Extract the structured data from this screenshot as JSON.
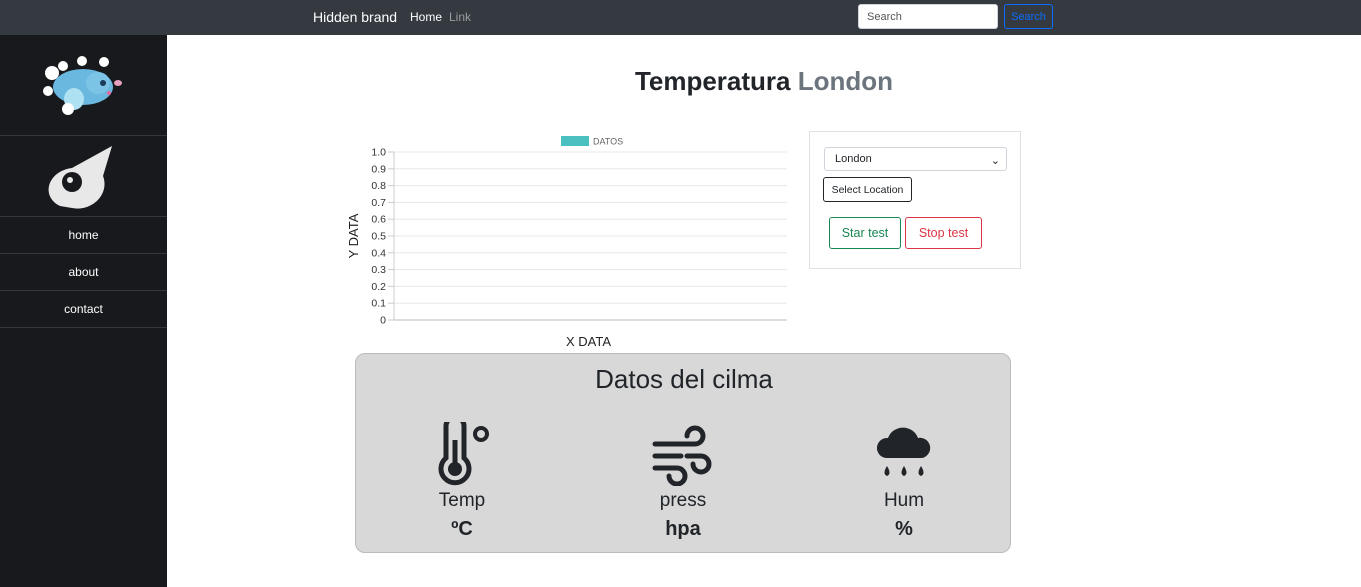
{
  "navbar": {
    "brand": "Hidden brand",
    "home": "Home",
    "link": "Link",
    "search_placeholder": "Search",
    "search_button": "Search"
  },
  "sidebar": {
    "items": [
      {
        "label": "home"
      },
      {
        "label": "about"
      },
      {
        "label": "contact"
      }
    ]
  },
  "header": {
    "title": "Temperatura",
    "city": "London"
  },
  "chart_data": {
    "type": "bar",
    "legend": [
      "DATOS"
    ],
    "legend_color": "#4bc0c0",
    "series": [
      {
        "name": "DATOS",
        "values": []
      }
    ],
    "categories": [],
    "xlabel": "X DATA",
    "ylabel": "Y DATA",
    "ylim": [
      0,
      1
    ],
    "yticks": [
      "1.0",
      "0.9",
      "0.8",
      "0.7",
      "0.6",
      "0.5",
      "0.4",
      "0.3",
      "0.2",
      "0.1",
      "0"
    ],
    "grid": true,
    "legend_position": "top"
  },
  "location": {
    "selected": "London",
    "select_button": "Select Location",
    "start_button": "Star test",
    "stop_button": "Stop test"
  },
  "climate": {
    "title": "Datos del cilma",
    "metrics": [
      {
        "label": "Temp",
        "unit": "ºC",
        "icon": "thermometer-icon"
      },
      {
        "label": "press",
        "unit": "hpa",
        "icon": "wind-icon"
      },
      {
        "label": "Hum",
        "unit": "%",
        "icon": "cloud-rain-icon"
      }
    ]
  },
  "colors": {
    "navbar": "#343a40",
    "sidebar": "#17191c",
    "primary": "#0d6efd",
    "success": "#198754",
    "danger": "#dc3545",
    "panel": "#d8d8d8"
  }
}
